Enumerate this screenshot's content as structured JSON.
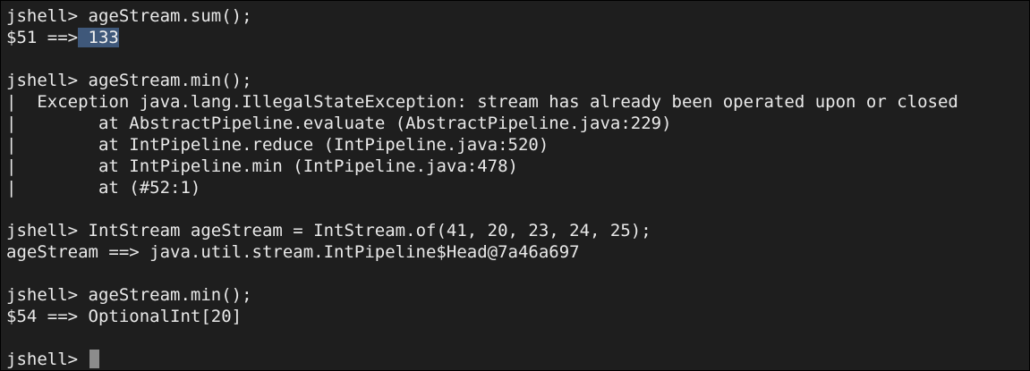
{
  "colors": {
    "background": "#1e1e1e",
    "text": "#e9e9e9",
    "selection": "#3f587a",
    "cursor": "#8c8c8c",
    "border": "#000000"
  },
  "terminal": {
    "prompt": "jshell> ",
    "gutter": "|",
    "cmd1": "ageStream.sum();",
    "out1_prefix": "$51 ==>",
    "out1_selected": " 133",
    "cmd2": "ageStream.min();",
    "error_lines": [
      "  Exception java.lang.IllegalStateException: stream has already been operated upon or closed",
      "        at AbstractPipeline.evaluate (AbstractPipeline.java:229)",
      "        at IntPipeline.reduce (IntPipeline.java:520)",
      "        at IntPipeline.min (IntPipeline.java:478)",
      "        at (#52:1)"
    ],
    "cmd3": "IntStream ageStream = IntStream.of(41, 20, 23, 24, 25);",
    "out3": "ageStream ==> java.util.stream.IntPipeline$Head@7a46a697",
    "cmd4": "ageStream.min();",
    "out4": "$54 ==> OptionalInt[20]"
  }
}
